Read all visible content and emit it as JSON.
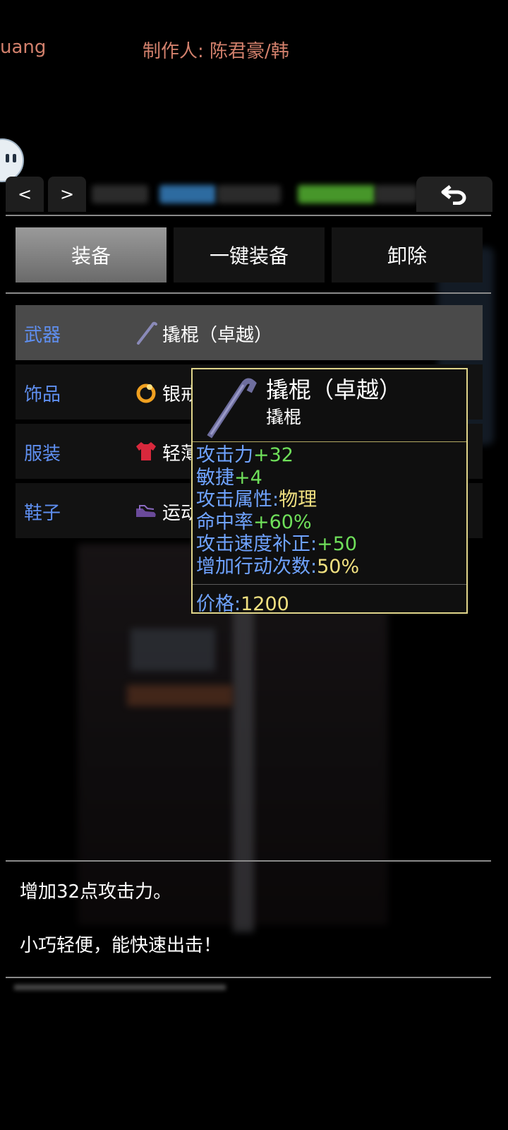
{
  "credits": {
    "left": "uang",
    "right": "制作人: 陈君豪/韩"
  },
  "nav": {
    "prev": "<",
    "next": ">"
  },
  "tabs": [
    {
      "label": "装备"
    },
    {
      "label": "一键装备"
    },
    {
      "label": "卸除"
    }
  ],
  "slots": [
    {
      "label": "武器",
      "item": "撬棍（卓越）",
      "icon": "crowbar-icon"
    },
    {
      "label": "饰品",
      "item": "银戒指",
      "icon": "ring-icon"
    },
    {
      "label": "服装",
      "item": "轻薄运动衣（优良）",
      "icon": "shirt-icon"
    },
    {
      "label": "鞋子",
      "item": "运动鞋（优良）",
      "icon": "shoes-icon"
    }
  ],
  "tooltip": {
    "title": "撬棍（卓越）",
    "subtitle": "撬棍",
    "stats": [
      {
        "name": "攻击力",
        "value": "+32"
      },
      {
        "name": "敏捷",
        "value": "+4"
      },
      {
        "name": "攻击属性:",
        "value": "物理"
      },
      {
        "name": "命中率",
        "value": "+60%"
      },
      {
        "name": "攻击速度补正:",
        "value": "+50"
      },
      {
        "name": "增加行动次数:",
        "value": "50%"
      }
    ],
    "price_label": "价格:",
    "price": "1200"
  },
  "description": {
    "line1": "增加32点攻击力。",
    "line2": "小巧轻便，能快速出击！"
  },
  "colors": {
    "slot_label": "#5f8ff0",
    "stat_name": "#6fa3ff",
    "stat_value_green": "#6fe05a",
    "stat_value_yellow": "#f0e080",
    "tooltip_border": "#e0d58a",
    "credits": "#d2806c"
  }
}
